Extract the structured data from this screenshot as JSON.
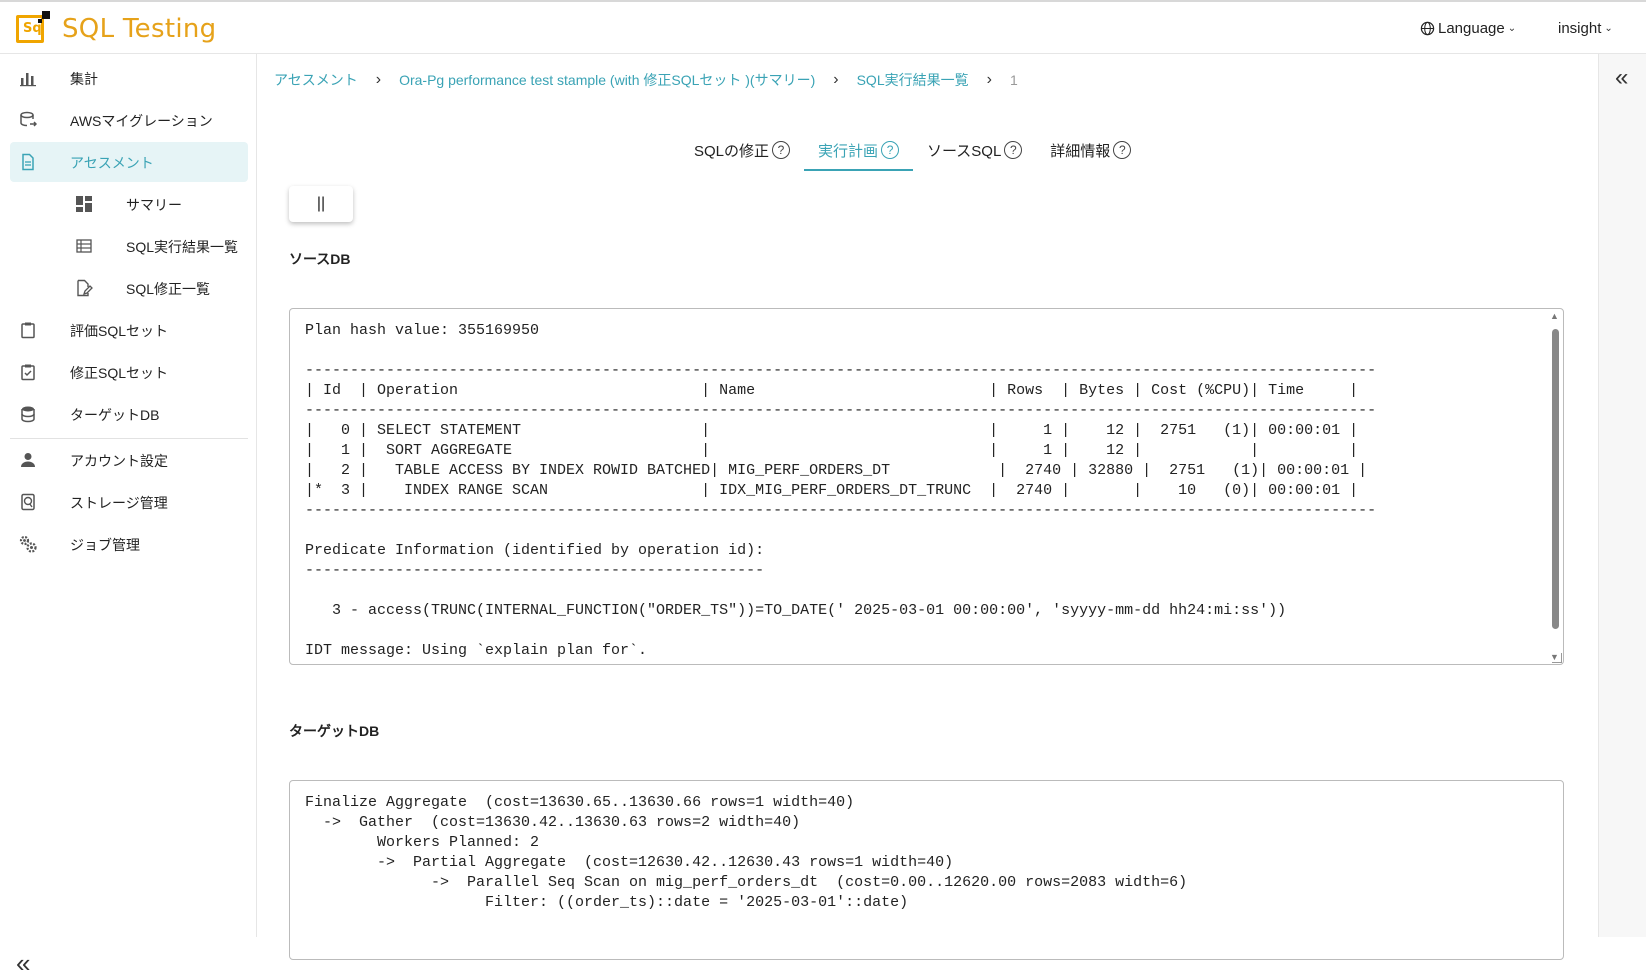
{
  "app": {
    "title": "SQL Testing",
    "logo_text": "Sq"
  },
  "header": {
    "language_label": "Language",
    "user_label": "insight"
  },
  "sidebar": {
    "items": [
      {
        "label": "集計",
        "icon": "bar-chart-icon"
      },
      {
        "label": "AWSマイグレーション",
        "icon": "database-migration-icon"
      },
      {
        "label": "アセスメント",
        "icon": "document-icon",
        "active": true
      },
      {
        "label": "サマリー",
        "icon": "dashboard-icon"
      },
      {
        "label": "SQL実行結果一覧",
        "icon": "list-icon"
      },
      {
        "label": "SQL修正一覧",
        "icon": "edit-document-icon"
      },
      {
        "label": "評価SQLセット",
        "icon": "clipboard-icon"
      },
      {
        "label": "修正SQLセット",
        "icon": "clipboard-check-icon"
      },
      {
        "label": "ターゲットDB",
        "icon": "database-icon"
      },
      {
        "label": "アカウント設定",
        "icon": "person-icon"
      },
      {
        "label": "ストレージ管理",
        "icon": "storage-icon"
      },
      {
        "label": "ジョブ管理",
        "icon": "gears-icon"
      }
    ]
  },
  "breadcrumb": {
    "items": [
      "アセスメント",
      "Ora-Pg performance test stample (with 修正SQLセット )(サマリー)",
      "SQL実行結果一覧"
    ],
    "current": "1"
  },
  "tabs": [
    {
      "label": "SQLの修正",
      "active": false
    },
    {
      "label": "実行計画",
      "active": true
    },
    {
      "label": "ソースSQL",
      "active": false
    },
    {
      "label": "詳細情報",
      "active": false
    }
  ],
  "pause_button": {
    "label": "||"
  },
  "source_db": {
    "label": "ソースDB",
    "plan": "Plan hash value: 355169950\n\n-----------------------------------------------------------------------------------------------------------------------\n| Id  | Operation                           | Name                          | Rows  | Bytes | Cost (%CPU)| Time     |\n-----------------------------------------------------------------------------------------------------------------------\n|   0 | SELECT STATEMENT                    |                               |     1 |    12 |  2751   (1)| 00:00:01 |\n|   1 |  SORT AGGREGATE                     |                               |     1 |    12 |            |          |\n|   2 |   TABLE ACCESS BY INDEX ROWID BATCHED| MIG_PERF_ORDERS_DT            |  2740 | 32880 |  2751   (1)| 00:00:01 |\n|*  3 |    INDEX RANGE SCAN                 | IDX_MIG_PERF_ORDERS_DT_TRUNC  |  2740 |       |    10   (0)| 00:00:01 |\n-----------------------------------------------------------------------------------------------------------------------\n\nPredicate Information (identified by operation id):\n---------------------------------------------------\n\n   3 - access(TRUNC(INTERNAL_FUNCTION(\"ORDER_TS\"))=TO_DATE(' 2025-03-01 00:00:00', 'syyyy-mm-dd hh24:mi:ss'))\n\nIDT message: Using `explain plan for`."
  },
  "target_db": {
    "label": "ターゲットDB",
    "plan": "Finalize Aggregate  (cost=13630.65..13630.66 rows=1 width=40)\n  ->  Gather  (cost=13630.42..13630.63 rows=2 width=40)\n        Workers Planned: 2\n        ->  Partial Aggregate  (cost=12630.42..12630.43 rows=1 width=40)\n              ->  Parallel Seq Scan on mig_perf_orders_dt  (cost=0.00..12620.00 rows=2083 width=6)\n                    Filter: ((order_ts)::date = '2025-03-01'::date)"
  },
  "colors": {
    "accent": "#3aa3b5",
    "brand": "#e6a21a",
    "active_bg": "#e6f4f6"
  }
}
